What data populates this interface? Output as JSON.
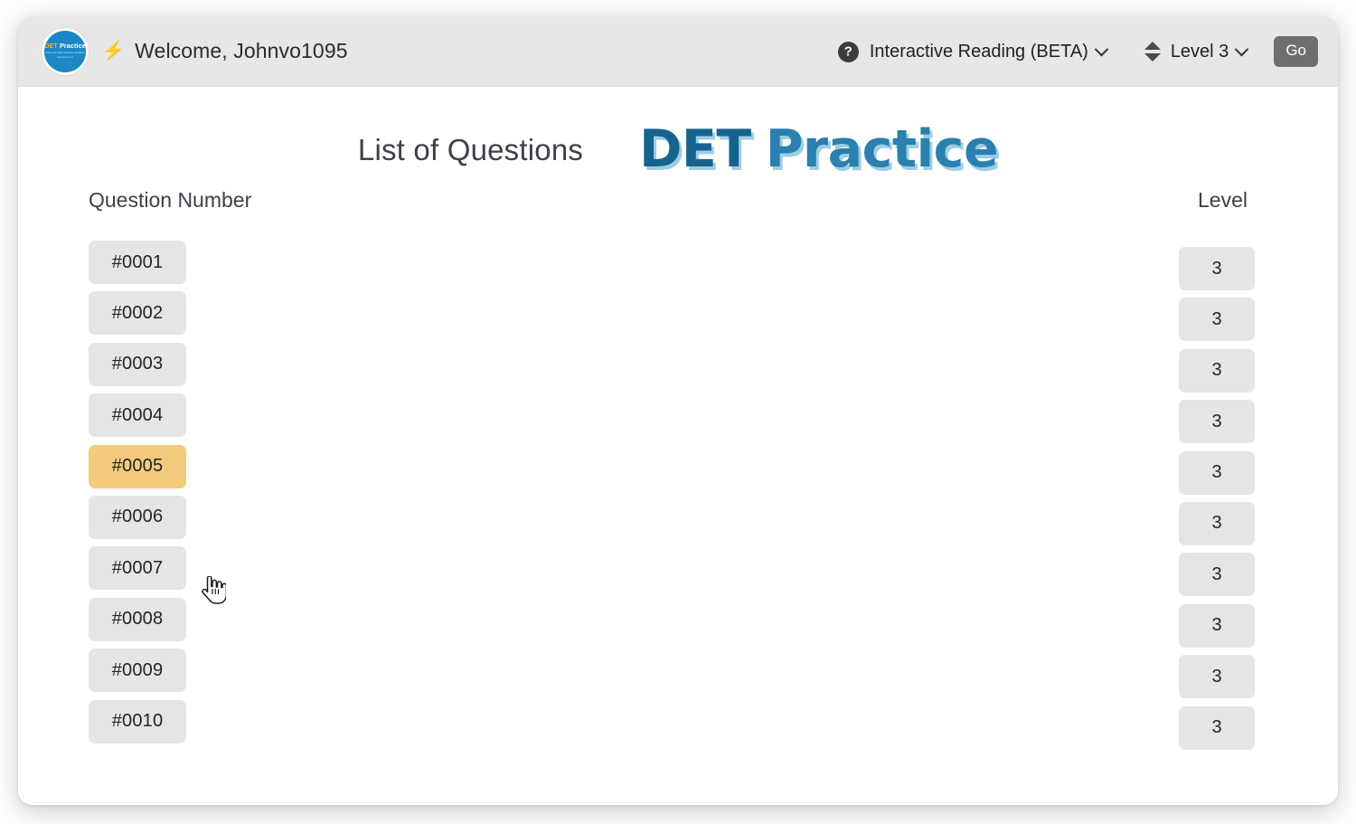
{
  "header": {
    "logo": {
      "name": "det-practice-logo",
      "line1_a": "DET",
      "line1_b": "Practice",
      "line2": "All-in-one DET practice platform",
      "line3": "detpractice.com"
    },
    "bolt_icon": "lightning-bolt-icon",
    "welcome": "Welcome, Johnvo1095",
    "help_icon": "question-mark-icon",
    "mode_select": {
      "label": "Interactive Reading (BETA)",
      "chevron": "chevron-down-icon"
    },
    "updown_icon": "sort-updown-icon",
    "level_select": {
      "label": "Level 3",
      "chevron": "chevron-down-icon"
    },
    "go_button": "Go"
  },
  "main": {
    "title": "List of Questions",
    "brand": {
      "det": "DET",
      "practice": "Practice"
    },
    "columns": {
      "question_number": "Question Number",
      "level": "Level"
    },
    "rows": [
      {
        "question": "#0001",
        "level": "3",
        "highlighted": false
      },
      {
        "question": "#0002",
        "level": "3",
        "highlighted": false
      },
      {
        "question": "#0003",
        "level": "3",
        "highlighted": false
      },
      {
        "question": "#0004",
        "level": "3",
        "highlighted": false
      },
      {
        "question": "#0005",
        "level": "3",
        "highlighted": true
      },
      {
        "question": "#0006",
        "level": "3",
        "highlighted": false
      },
      {
        "question": "#0007",
        "level": "3",
        "highlighted": false
      },
      {
        "question": "#0008",
        "level": "3",
        "highlighted": false
      },
      {
        "question": "#0009",
        "level": "3",
        "highlighted": false
      },
      {
        "question": "#0010",
        "level": "3",
        "highlighted": false
      }
    ]
  },
  "cursor": {
    "icon": "pointing-hand-cursor"
  },
  "colors": {
    "header_bg": "#e7e7e7",
    "chip_bg": "#e5e5e6",
    "chip_highlight": "#f2cb7d",
    "go_button_bg": "#6e6e6e",
    "logo_blue": "#1b87c5",
    "brand_det": "#16648e",
    "brand_practice": "#2a80ae",
    "brand_shadow": "#8cc4de"
  }
}
